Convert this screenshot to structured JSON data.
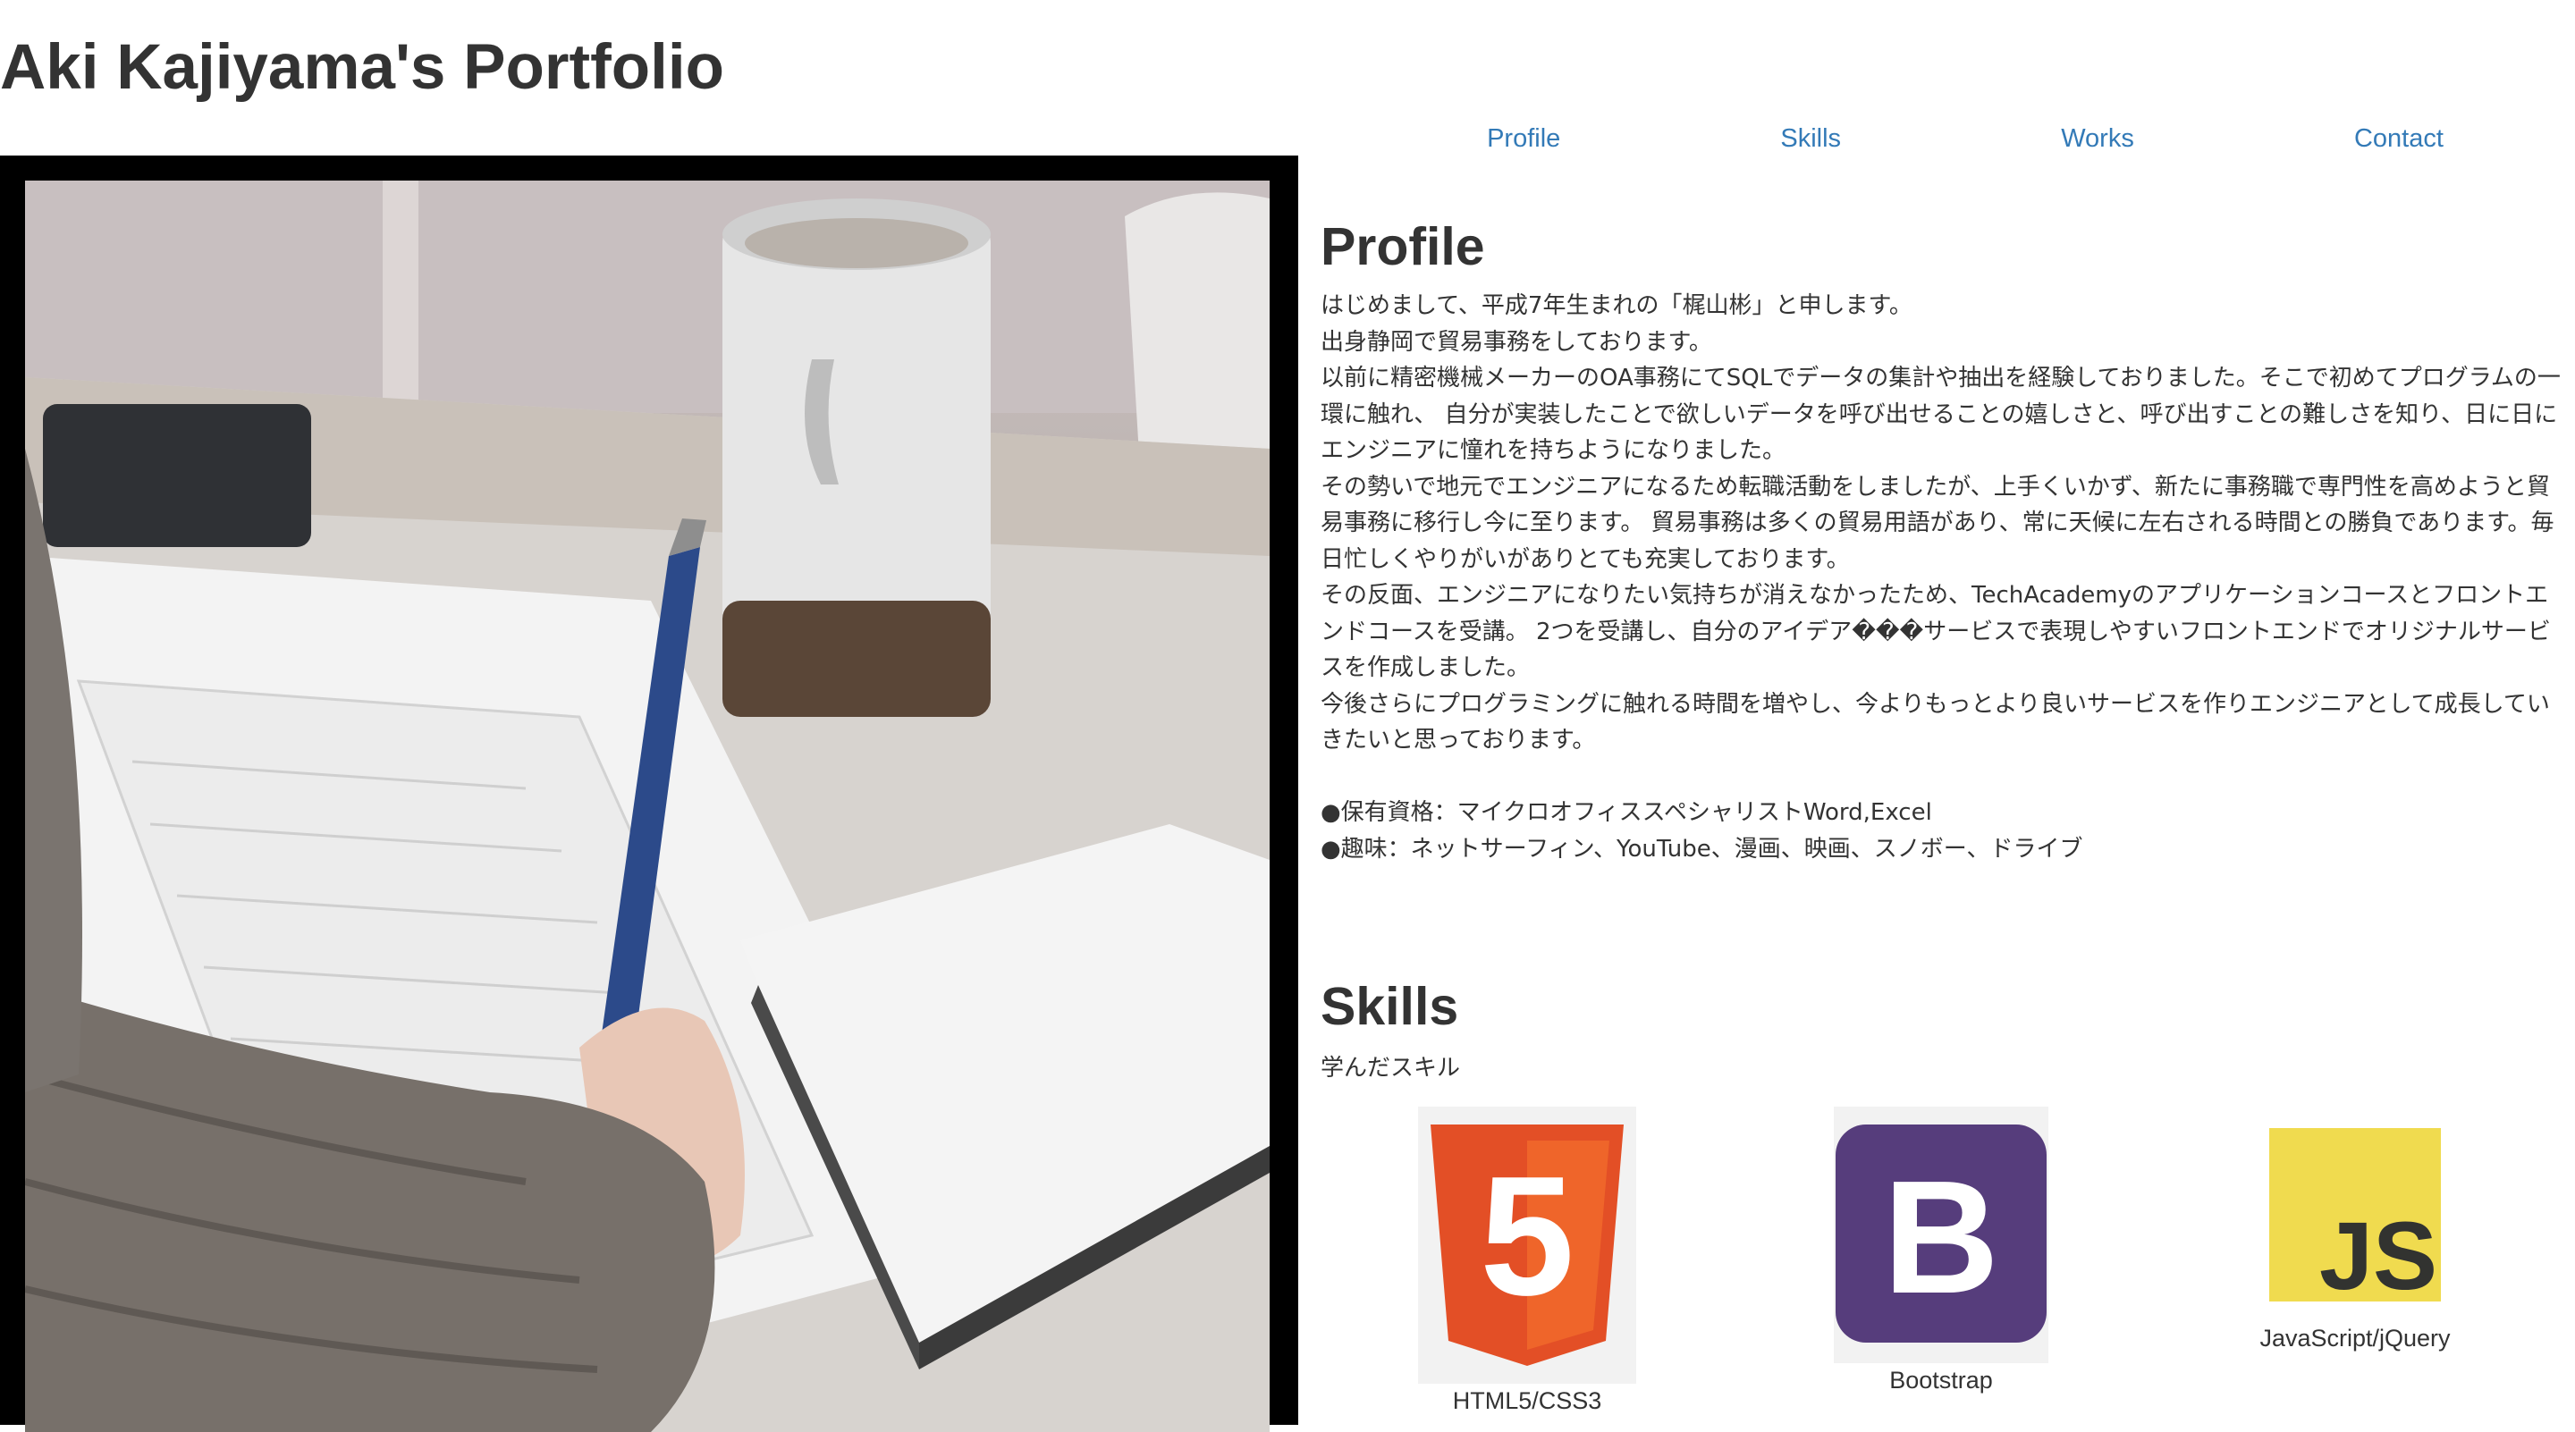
{
  "site": {
    "title": "Aki Kajiyama's Portfolio"
  },
  "nav": {
    "items": [
      {
        "label": "Profile"
      },
      {
        "label": "Skills"
      },
      {
        "label": "Works"
      },
      {
        "label": "Contact"
      }
    ]
  },
  "colors": {
    "link": "#337ab7",
    "text": "#333333",
    "frame": "#000000",
    "html5_orange": "#e34f26",
    "bootstrap_purple": "#563d7c",
    "js_yellow": "#f0db4f"
  },
  "profile": {
    "heading": "Profile",
    "paragraphs": [
      "はじめまして、平成7年生まれの「梶山彬」と申します。",
      "出身静岡で貿易事務をしております。",
      "以前に精密機械メーカーのOA事務にてSQLでデータの集計や抽出を経験しておりました。そこで初めてプログラムの一環に触れ、 自分が実装したことで欲しいデータを呼び出せることの嬉しさと、呼び出すことの難しさを知り、日に日にエンジニアに憧れを持ちようになりました。",
      "その勢いで地元でエンジニアになるため転職活動をしましたが、上手くいかず、新たに事務職で専門性を高めようと貿易事務に移行し今に至ります。 貿易事務は多くの貿易用語があり、常に天候に左右される時間との勝負であります。毎日忙しくやりがいがありとても充実しております。",
      "その反面、エンジニアになりたい気持ちが消えなかったため、TechAcademyのアプリケーションコースとフロントエンドコースを受講。 2つを受講し、自分のアイデア���サービスで表現しやすいフロントエンドでオリジナルサービスを作成しました。",
      "今後さらにプログラミングに触れる時間を増やし、今よりもっとより良いサービスを作りエンジニアとして成長していきたいと思っております。"
    ],
    "qualifications": "●保有資格：マイクロオフィススペシャリストWord,Excel",
    "hobbies": "●趣味：ネットサーフィン、YouTube、漫画、映画、スノボー、ドライブ"
  },
  "skills": {
    "heading": "Skills",
    "subtitle": "学んだスキル",
    "items": [
      {
        "label": "HTML5/CSS3",
        "icon": "html5-icon",
        "logo_text": "5"
      },
      {
        "label": "Bootstrap",
        "icon": "bootstrap-icon",
        "logo_text": "B"
      },
      {
        "label": "JavaScript/jQuery",
        "icon": "javascript-icon",
        "logo_text": "JS"
      }
    ]
  }
}
